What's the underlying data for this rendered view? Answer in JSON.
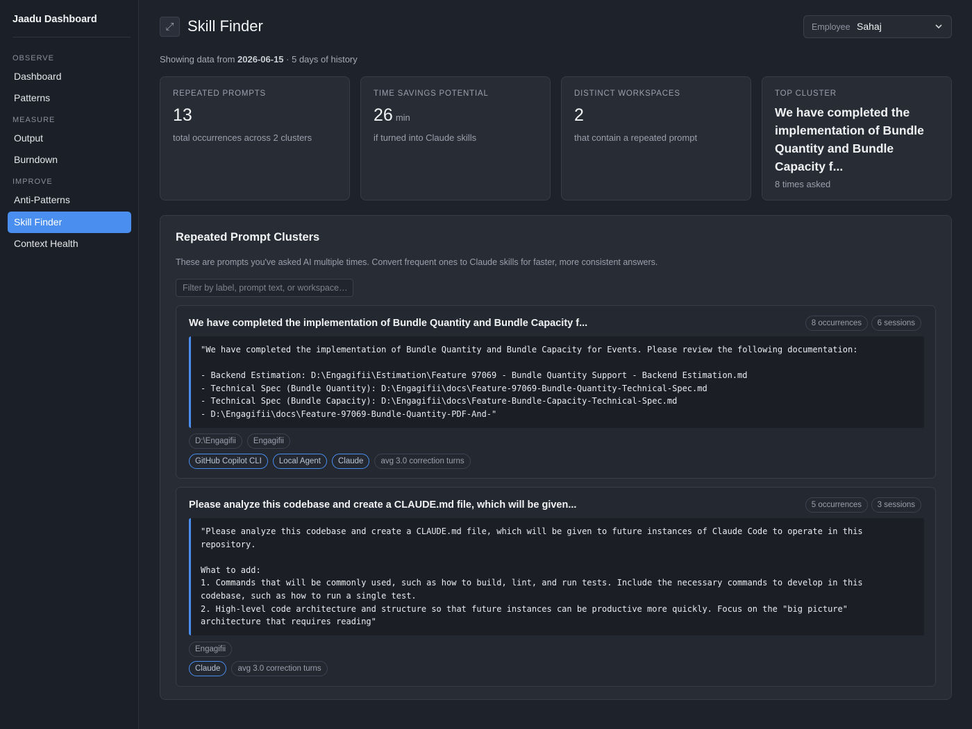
{
  "app": {
    "brand": "Jaadu Dashboard"
  },
  "sidebar": {
    "sections": [
      {
        "label": "OBSERVE",
        "items": [
          {
            "label": "Dashboard"
          },
          {
            "label": "Patterns"
          }
        ]
      },
      {
        "label": "MEASURE",
        "items": [
          {
            "label": "Output"
          },
          {
            "label": "Burndown"
          }
        ]
      },
      {
        "label": "IMPROVE",
        "items": [
          {
            "label": "Anti-Patterns"
          },
          {
            "label": "Skill Finder",
            "active": true
          },
          {
            "label": "Context Health"
          }
        ]
      }
    ]
  },
  "header": {
    "expand_icon": "expand-icon",
    "title": "Skill Finder",
    "employee": {
      "label": "Employee",
      "value": "Sahaj",
      "chevron_icon": "chevron-down-icon"
    }
  },
  "history": {
    "prefix": "Showing data from",
    "date": "2026-06-15",
    "suffix": "· 5 days of history"
  },
  "stats": {
    "repeated_prompts": {
      "label": "REPEATED PROMPTS",
      "value": "13",
      "sub": "total occurrences across 2 clusters"
    },
    "time_savings": {
      "label": "TIME SAVINGS POTENTIAL",
      "value": "26",
      "unit": "min",
      "sub": "if turned into Claude skills"
    },
    "workspaces": {
      "label": "DISTINCT WORKSPACES",
      "value": "2",
      "sub": "that contain a repeated prompt"
    },
    "top_cluster": {
      "label": "TOP CLUSTER",
      "value": "We have completed the implementation of Bundle Quantity and Bundle Capacity f...",
      "sub": "8 times asked"
    }
  },
  "clusters": {
    "title": "Repeated Prompt Clusters",
    "description": "These are prompts you've asked AI multiple times. Convert frequent ones to Claude skills for faster, more consistent answers.",
    "filter_placeholder": "Filter by label, prompt text, or workspace…",
    "items": [
      {
        "title": "We have completed the implementation of Bundle Quantity and Bundle Capacity f...",
        "occurrences": "8 occurrences",
        "sessions": "6 sessions",
        "prompt": "\"We have completed the implementation of Bundle Quantity and Bundle Capacity for Events. Please review the following documentation:\n\n- Backend Estimation: D:\\Engagifii\\Estimation\\Feature 97069 - Bundle Quantity Support - Backend Estimation.md\n- Technical Spec (Bundle Quantity): D:\\Engagifii\\docs\\Feature-97069-Bundle-Quantity-Technical-Spec.md\n- Technical Spec (Bundle Capacity): D:\\Engagifii\\docs\\Feature-Bundle-Capacity-Technical-Spec.md\n- D:\\Engagifii\\docs\\Feature-97069-Bundle-Quantity-PDF-And-\"",
        "workspaces": [
          "D:\\Engagifii",
          "Engagifii"
        ],
        "tools": [
          "GitHub Copilot CLI",
          "Local Agent",
          "Claude"
        ],
        "avg": "avg 3.0 correction turns"
      },
      {
        "title": "Please analyze this codebase and create a CLAUDE.md file, which will be given...",
        "occurrences": "5 occurrences",
        "sessions": "3 sessions",
        "prompt": "\"Please analyze this codebase and create a CLAUDE.md file, which will be given to future instances of Claude Code to operate in this\nrepository.\n\nWhat to add:\n1. Commands that will be commonly used, such as how to build, lint, and run tests. Include the necessary commands to develop in this\ncodebase, such as how to run a single test.\n2. High-level code architecture and structure so that future instances can be productive more quickly. Focus on the \"big picture\"\narchitecture that requires reading\"",
        "workspaces": [
          "Engagifii"
        ],
        "tools": [
          "Claude"
        ],
        "avg": "avg 3.0 correction turns"
      }
    ]
  },
  "colors": {
    "accent": "#4a8ff0",
    "background": "#1e222b",
    "sidebar": "#1b1f27",
    "card": "#272c35"
  }
}
